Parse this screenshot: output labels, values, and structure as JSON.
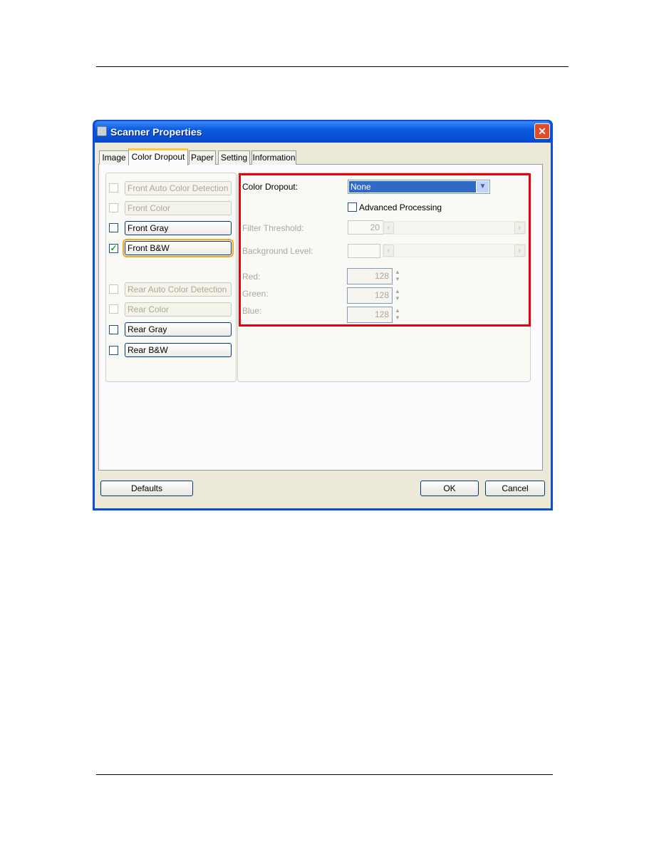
{
  "dialog": {
    "title": "Scanner Properties",
    "close_icon": "close-icon",
    "tabs": [
      {
        "label": "Image"
      },
      {
        "label": "Color Dropout",
        "selected": true
      },
      {
        "label": "Paper"
      },
      {
        "label": "Setting"
      },
      {
        "label": "Information"
      }
    ],
    "image_options": [
      {
        "label": "Front Auto Color Detection",
        "checked": false,
        "enabled": false
      },
      {
        "label": "Front Color",
        "checked": false,
        "enabled": false
      },
      {
        "label": "Front Gray",
        "checked": false,
        "enabled": true
      },
      {
        "label": "Front B&W",
        "checked": true,
        "enabled": true,
        "focused": true
      },
      {
        "label": "Rear Auto Color Detection",
        "checked": false,
        "enabled": false
      },
      {
        "label": "Rear Color",
        "checked": false,
        "enabled": false
      },
      {
        "label": "Rear Gray",
        "checked": false,
        "enabled": true
      },
      {
        "label": "Rear B&W",
        "checked": false,
        "enabled": true
      }
    ],
    "color_dropout": {
      "label": "Color Dropout:",
      "selected": "None",
      "advanced_label": "Advanced Processing",
      "advanced_checked": false,
      "filter_threshold_label": "Filter Threshold:",
      "filter_threshold_value": "20",
      "background_level_label": "Background Level:",
      "background_level_value": "",
      "red_label": "Red:",
      "red_value": "128",
      "green_label": "Green:",
      "green_value": "128",
      "blue_label": "Blue:",
      "blue_value": "128",
      "highlight_color": "#e8000f"
    },
    "buttons": {
      "defaults": "Defaults",
      "ok": "OK",
      "cancel": "Cancel"
    }
  }
}
